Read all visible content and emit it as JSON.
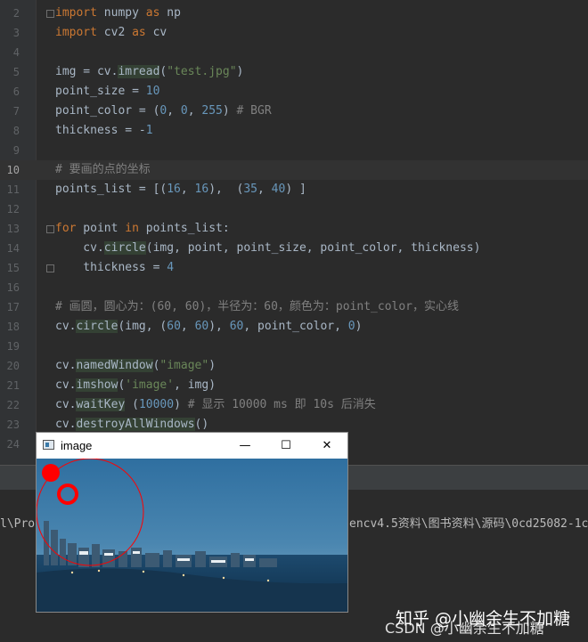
{
  "editor": {
    "current_line": "10",
    "lines": [
      {
        "n": "2",
        "text": "import numpy as np"
      },
      {
        "n": "3",
        "text": "import cv2 as cv"
      },
      {
        "n": "4",
        "text": ""
      },
      {
        "n": "5",
        "text": "img = cv.imread(\"test.jpg\")"
      },
      {
        "n": "6",
        "text": "point_size = 10"
      },
      {
        "n": "7",
        "text": "point_color = (0, 0, 255) # BGR"
      },
      {
        "n": "8",
        "text": "thickness = -1"
      },
      {
        "n": "9",
        "text": ""
      },
      {
        "n": "10",
        "text": "# 要画的点的坐标"
      },
      {
        "n": "11",
        "text": "points_list = [(16, 16),  (35, 40) ]"
      },
      {
        "n": "12",
        "text": ""
      },
      {
        "n": "13",
        "text": "for point in points_list:"
      },
      {
        "n": "14",
        "text": "    cv.circle(img, point, point_size, point_color, thickness)"
      },
      {
        "n": "15",
        "text": "    thickness = 4"
      },
      {
        "n": "16",
        "text": ""
      },
      {
        "n": "17",
        "text": "# 画圆，圆心为：(60, 60)，半径为：60，颜色为：point_color，实心线"
      },
      {
        "n": "18",
        "text": "cv.circle(img, (60, 60), 60, point_color, 0)"
      },
      {
        "n": "19",
        "text": ""
      },
      {
        "n": "20",
        "text": "cv.namedWindow(\"image\")"
      },
      {
        "n": "21",
        "text": "cv.imshow('image', img)"
      },
      {
        "n": "22",
        "text": "cv.waitKey (10000) # 显示 10000 ms 即 10s 后消失"
      },
      {
        "n": "23",
        "text": "cv.destroyAllWindows()"
      },
      {
        "n": "24",
        "text": ""
      }
    ]
  },
  "console": {
    "path_left": "l\\Pro",
    "path_right": "encv4.5资料\\图书资料\\源码\\0cd25082-1c"
  },
  "image_window": {
    "title": "image",
    "minimize_glyph": "—",
    "maximize_glyph": "☐",
    "close_glyph": "✕",
    "icon": "window-app-icon",
    "drawn_color": "#ff0000"
  },
  "watermarks": {
    "zhihu": "知乎 @小幽余生不加糖",
    "csdn": "CSDN @小幽余生不加糖"
  }
}
